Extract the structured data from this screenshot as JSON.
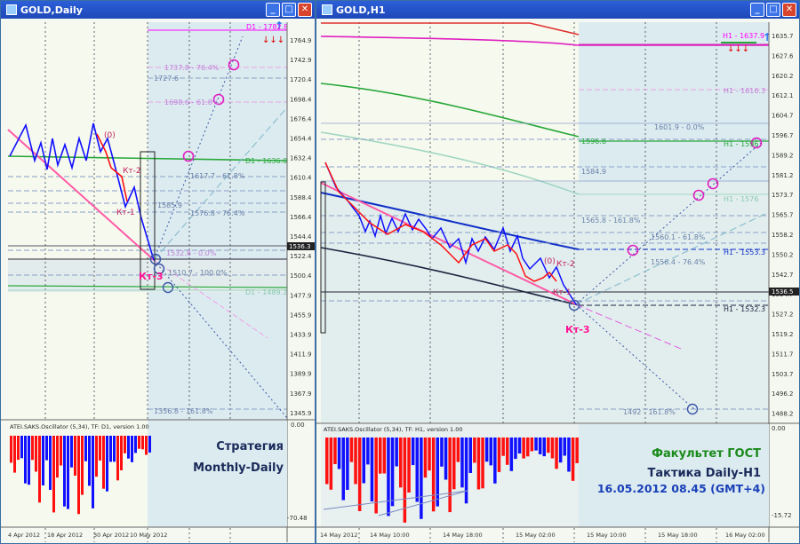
{
  "left": {
    "title": "GOLD,Daily",
    "price_axis": [
      "1764.9",
      "1742.9",
      "1720.4",
      "1698.4",
      "1676.4",
      "1654.4",
      "1632.4",
      "1610.4",
      "1588.4",
      "1566.4",
      "1544.4",
      "1522.4",
      "1500.4",
      "1477.9",
      "1455.9",
      "1433.9",
      "1411.9",
      "1389.9",
      "1367.9",
      "1345.9"
    ],
    "current_price": "1536.3",
    "date_axis": [
      "4 Apr 2012",
      "18 Apr 2012",
      "30 Apr 2012",
      "10 May 2012"
    ],
    "level_labels": [
      "D1 - 1782.8",
      "1737.8 - 76.4%",
      "1727.6",
      "1698.6 - 61.8%",
      "D1 - 1636.0",
      "1617.7 - 61.8%",
      "1585.9",
      "1576.8 - 76.4%",
      "1532.8 - 0.0%",
      "1510.7 - 100.0%",
      "D1 - 1489.2",
      "1356.8 - 161.8%"
    ],
    "wave_labels": [
      "(0)",
      "Кт-2",
      "Кт-1",
      "Кт-3"
    ],
    "osc_title": "ATEI.SAKS.Oscillator (5,34), TF: D1, version 1.00",
    "osc_axis": [
      "0.00",
      "-70.48"
    ],
    "strategy_line1": "Стратегия",
    "strategy_line2": "Monthly-Daily"
  },
  "right": {
    "title": "GOLD,H1",
    "price_axis": [
      "1635.7",
      "1627.6",
      "1620.2",
      "1612.1",
      "1604.7",
      "1596.7",
      "1589.2",
      "1581.2",
      "1573.7",
      "1565.7",
      "1558.2",
      "1550.2",
      "1542.7",
      "1534.7",
      "1527.2",
      "1519.2",
      "1511.7",
      "1503.7",
      "1496.2",
      "1488.2"
    ],
    "current_price": "1536.5",
    "date_axis": [
      "14 May 2012",
      "14 May 10:00",
      "14 May 18:00",
      "15 May 02:00",
      "15 May 10:00",
      "15 May 18:00",
      "16 May 02:00"
    ],
    "level_labels": [
      "H1 - 1637.9",
      "H1 - 1616.3",
      "1601.9 - 0.0%",
      "1596.6",
      "H1 - 1596",
      "1584.9",
      "H1 - 1576",
      "1565.8 - 161.8%",
      "1560.1 - 61.8%",
      "1556.4 - 76.4%",
      "H1 - 1553.3",
      "H1 - 1532.3",
      "1492 - 161.8%"
    ],
    "wave_labels": [
      "(0)",
      "Кт-2",
      "Кт-1",
      "Кт-3"
    ],
    "osc_title": "ATEI.SAKS.Oscillator (5,34), TF: H1, version 1.00",
    "osc_axis": [
      "0.00",
      "-15.72"
    ],
    "faculty": "Факультет ГОСТ",
    "tactic": "Тактика Daily-H1",
    "datetime": "16.05.2012 08.45 (GMT+4)"
  },
  "colors": {
    "bull": "#1010ff",
    "bear": "#ff1010",
    "faculty": "#1a8a1a",
    "text_dark": "#1a2a5a",
    "accent": "#ff1493"
  }
}
